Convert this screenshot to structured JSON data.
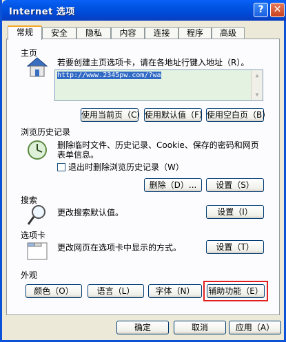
{
  "window": {
    "title": "Internet 选项",
    "help": "?",
    "close": "✕"
  },
  "tabs": [
    "常规",
    "安全",
    "隐私",
    "内容",
    "连接",
    "程序",
    "高级"
  ],
  "home": {
    "label": "主页",
    "description": "若要创建主页选项卡，请在各地址行键入地址（R）。",
    "url": "http://www.2345pw.com/?wa",
    "btn_current": "使用当前页（C）",
    "btn_default": "使用默认值（F）",
    "btn_blank": "使用空白页（B）"
  },
  "history": {
    "label": "浏览历史记录",
    "description_line1": "删除临时文件、历史记录、Cookie、保存的密码和网页",
    "description_line2": "表单信息。",
    "checkbox_label": "退出时删除浏览历史记录（W）",
    "btn_delete": "删除（D）...",
    "btn_settings": "设置（S）"
  },
  "search": {
    "label": "搜索",
    "description": "更改搜索默认值。",
    "btn_settings": "设置（I）"
  },
  "tabs_section": {
    "label": "选项卡",
    "description": "更改网页在选项卡中显示的方式。",
    "btn_settings": "设置（T）"
  },
  "appearance": {
    "label": "外观",
    "btn_colors": "颜色（O）",
    "btn_languages": "语言（L）",
    "btn_fonts": "字体（N）",
    "btn_accessibility": "辅助功能（E）"
  },
  "footer": {
    "ok": "确定",
    "cancel": "取消",
    "apply": "应用（A）"
  }
}
